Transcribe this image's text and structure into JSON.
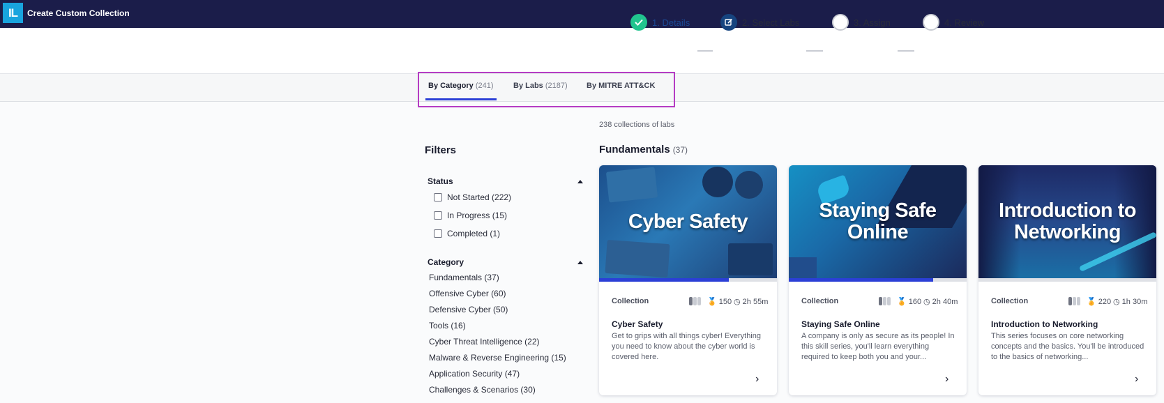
{
  "app": {
    "logo_text": "IL",
    "title": "Create Custom Collection"
  },
  "stepper": {
    "steps": [
      {
        "label": "1. Details",
        "state": "done"
      },
      {
        "label": "2. Select Labs",
        "state": "active"
      },
      {
        "label": "3. Assign",
        "state": "todo"
      },
      {
        "label": "4. Review",
        "state": "todo"
      }
    ]
  },
  "tabs": [
    {
      "label": "By Category",
      "count": "(241)",
      "active": true
    },
    {
      "label": "By Labs",
      "count": "(2187)",
      "active": false
    },
    {
      "label": "By MITRE ATT&CK",
      "count": "",
      "active": false
    }
  ],
  "filters": {
    "title": "Filters",
    "status": {
      "title": "Status",
      "options": [
        "Not Started (222)",
        "In Progress (15)",
        "Completed (1)"
      ]
    },
    "category": {
      "title": "Category",
      "items": [
        "Fundamentals (37)",
        "Offensive Cyber (60)",
        "Defensive Cyber (50)",
        "Tools (16)",
        "Cyber Threat Intelligence (22)",
        "Malware & Reverse Engineering (15)",
        "Application Security (47)",
        "Challenges & Scenarios (30)"
      ]
    }
  },
  "results": {
    "count_text": "238 collections of labs",
    "group": {
      "title": "Fundamentals",
      "count": "(37)"
    },
    "cards": [
      {
        "banner_text": "Cyber Safety",
        "kind": "Collection",
        "points": "150",
        "duration": "2h 55m",
        "title": "Cyber Safety",
        "description": "Get to grips with all things cyber! Everything you need to know about the cyber world is covered here.",
        "progress": 0.73,
        "difficulty": 1
      },
      {
        "banner_text": "Staying Safe Online",
        "kind": "Collection",
        "points": "160",
        "duration": "2h 40m",
        "title": "Staying Safe Online",
        "description": "A company is only as secure as its people! In this skill series, you'll learn everything required to keep both you and your...",
        "progress": 0.81,
        "difficulty": 1
      },
      {
        "banner_text": "Introduction to Networking",
        "kind": "Collection",
        "points": "220",
        "duration": "1h 30m",
        "title": "Introduction to Networking",
        "description": "This series focuses on core networking concepts and the basics. You'll be introduced to the basics of networking...",
        "progress": 0,
        "difficulty": 1
      }
    ]
  },
  "colors": {
    "topbar": "#1b1d4a",
    "accent": "#2b3fd6",
    "success": "#21c48e",
    "highlight": "#b53cc3"
  }
}
